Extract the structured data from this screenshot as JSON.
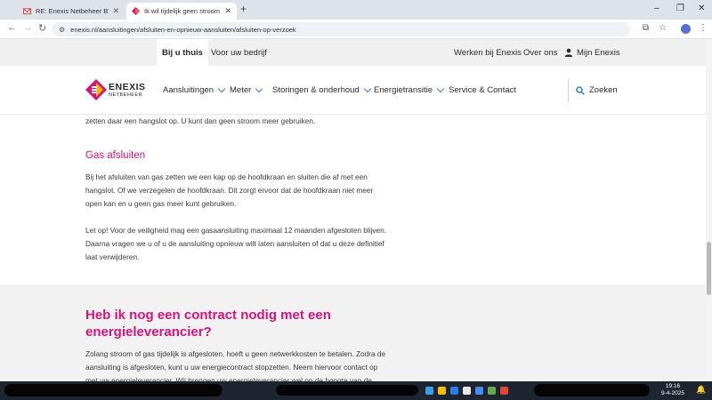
{
  "browser": {
    "tabs": [
      {
        "title": "RE: Enexis Netbeheer BV: Case",
        "active": false,
        "favicon": "gmail-icon"
      },
      {
        "title": "Ik wil tijdelijk geen stroom of g",
        "active": true,
        "favicon": "enexis-icon"
      }
    ],
    "new_tab_label": "+",
    "url": "enexis.nl/aansluitingen/afsluiten-en-opnieuw-aansluiten/afsluiten-op-verzoek"
  },
  "topnav": {
    "left": [
      "Bij u thuis",
      "Voor uw bedrijf"
    ],
    "right": [
      "Werken bij Enexis",
      "Over ons",
      "Mijn Enexis"
    ]
  },
  "logo": {
    "name": "ENEXIS",
    "sub": "NETBEHEER"
  },
  "mainnav": {
    "items": [
      "Aansluitingen",
      "Meter",
      "Storingen & onderhoud",
      "Energietransitie",
      "Service & Contact"
    ],
    "search": "Zoeken"
  },
  "content": {
    "intro_tail": "zetten daar een hangslot op. U kunt dan geen stroom meer gebruiken.",
    "gas_heading": "Gas afsluiten",
    "gas_p1": [
      "Bij het afsluiten van gas zetten we een kap op de hoofdkraan en sluiten die af met een",
      "hangslot. Of we verzegelen de hoofdkraan. Dit zorgt ervoor dat de hoofdkraan niet meer",
      "open kan en u geen gas meer kunt gebruiken."
    ],
    "gas_p2": [
      "Let op! Voor de veiligheid mag een gasaansluiting maximaal 12 maanden afgesloten blijven.",
      "Daarna vragen we u of u de aansluiting opnieuw wilt laten aansluiten of dat u deze definitief",
      "laat verwijderen."
    ],
    "contract_heading": "Heb ik nog een contract nodig met een energieleverancier?",
    "contract_p": [
      "Zolang stroom of gas tijdelijk is afgesloten, hoeft u geen netwerkkosten te betalen. Zodra de",
      "aansluiting is afgesloten, kunt u uw energiecontract stopzetten. Neem hiervoor contact op",
      "met uw energieleverancier. Wij brengen uw energieleverancier wel op de hoogte van de"
    ]
  },
  "taskbar": {
    "time": "19:16",
    "date": "9-4-2025"
  },
  "colors": {
    "brand_magenta": "#d2147b",
    "accent_blue": "#3a7fd0",
    "grey_bg": "#f2f2f2"
  }
}
